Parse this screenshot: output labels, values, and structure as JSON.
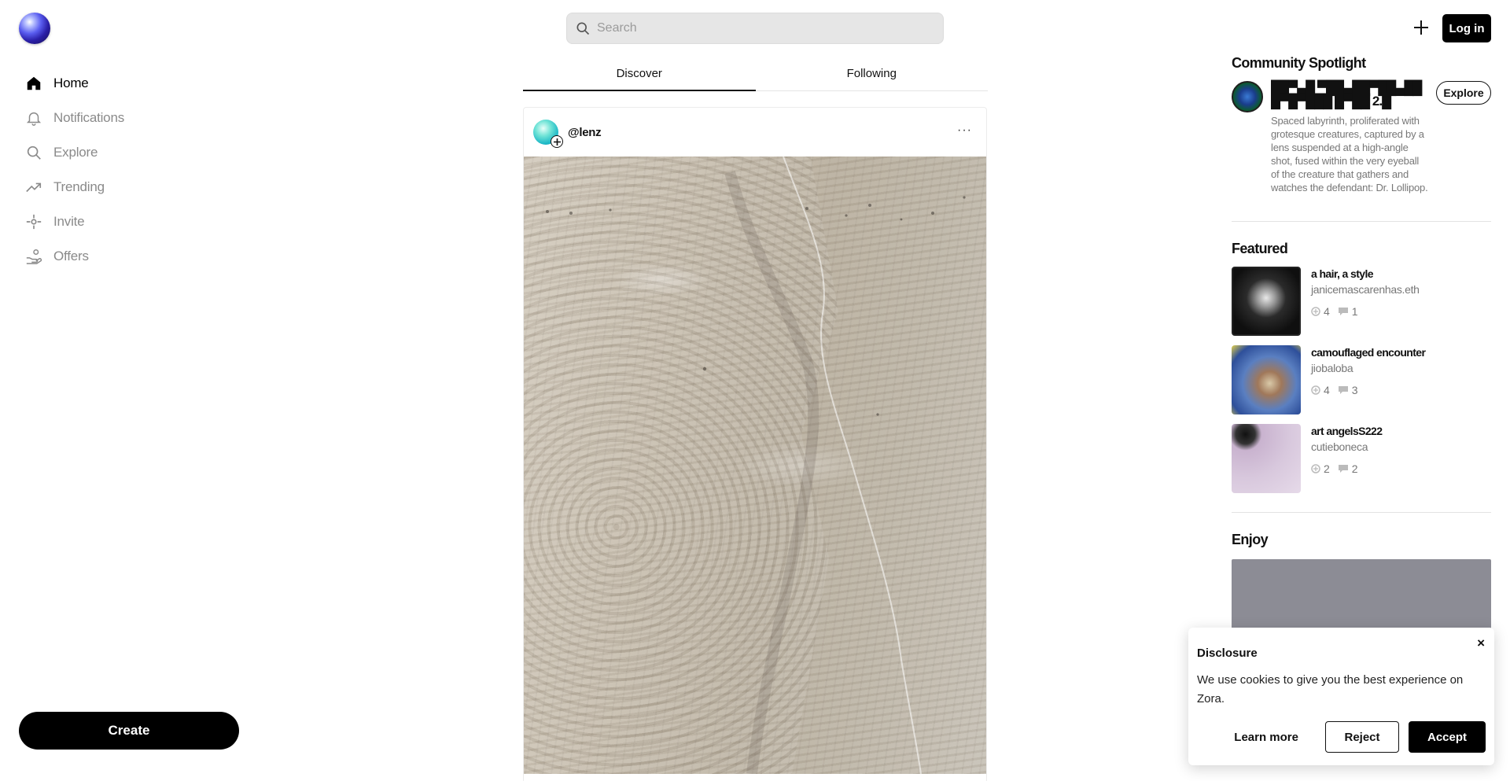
{
  "nav": {
    "items": [
      {
        "label": "Home",
        "icon": "home-icon",
        "active": true
      },
      {
        "label": "Notifications",
        "icon": "bell-icon"
      },
      {
        "label": "Explore",
        "icon": "search-icon"
      },
      {
        "label": "Trending",
        "icon": "trending-icon"
      },
      {
        "label": "Invite",
        "icon": "invite-icon"
      },
      {
        "label": "Offers",
        "icon": "offers-icon"
      }
    ],
    "create_label": "Create"
  },
  "search": {
    "placeholder": "Search"
  },
  "header": {
    "login_label": "Log in"
  },
  "feed": {
    "tabs": [
      {
        "label": "Discover",
        "active": true
      },
      {
        "label": "Following"
      }
    ],
    "post": {
      "author": "@lenz",
      "more": "···"
    }
  },
  "rail": {
    "spotlight": {
      "heading": "Community Spotlight",
      "title": "██▀▄█ ▀██▄██▀██▄███▀█▀███ █▀██ 2.█",
      "description": "Spaced labyrinth, proliferated with grotesque creatures, captured by a lens suspended at a high-angle shot, fused within the very eyeball of the creature that gathers and watches the defendant: Dr. Lollipop.",
      "explore_label": "Explore"
    },
    "featured": {
      "heading": "Featured",
      "items": [
        {
          "title": "a hair, a style",
          "creator": "janicemascarenhas.eth",
          "mints": "4",
          "comments": "1"
        },
        {
          "title": "camouflaged encounter",
          "creator": "jiobaloba",
          "mints": "4",
          "comments": "3"
        },
        {
          "title": "art angelsS222",
          "creator": "cutieboneca",
          "mints": "2",
          "comments": "2"
        }
      ]
    },
    "enjoy": {
      "heading": "Enjoy"
    }
  },
  "cookie": {
    "title": "Disclosure",
    "text": "We use cookies to give you the best experience on Zora.",
    "close": "×",
    "learn_label": "Learn more",
    "reject_label": "Reject",
    "accept_label": "Accept"
  }
}
